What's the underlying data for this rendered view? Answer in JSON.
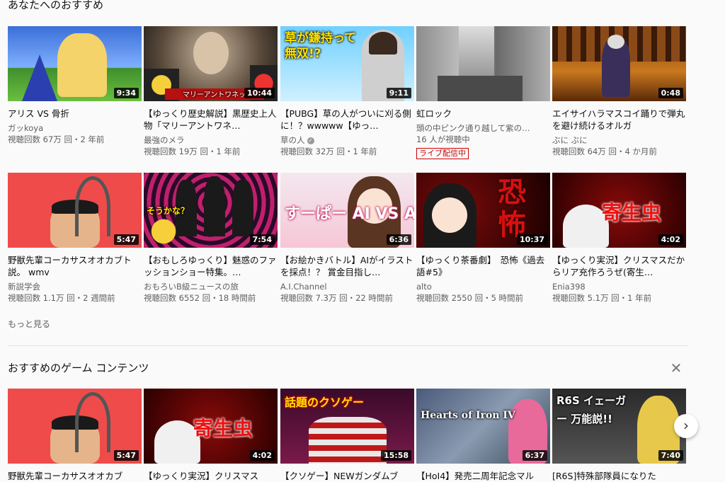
{
  "sections": {
    "recommended": "あなたへのおすすめ",
    "games": "おすすめのゲーム コンテンツ",
    "show_more": "もっと見る"
  },
  "icons": {
    "close": "close-icon",
    "next": "chevron-right-icon",
    "verified": "verified-check-icon"
  },
  "videos": [
    {
      "title": "アリス VS 骨折",
      "channel": "ガッkoya",
      "stats": "視聴回数 67万 回・2 年前",
      "duration": "9:34",
      "caption": ""
    },
    {
      "title": "【ゆっくり歴史解説】黒歴史上人物「マリーアントワネ…",
      "channel": "最強のメラ",
      "stats": "視聴回数 19万 回・1 年前",
      "duration": "10:44",
      "caption": "マリーアントワネット"
    },
    {
      "title": "【PUBG】草の人がついに刈る側に！？wwwww【ゆっ…",
      "channel": "草の人",
      "stats": "視聴回数 32万 回・1 年前",
      "duration": "9:11",
      "caption": "草が鎌持って 無双!?"
    },
    {
      "title": "虹ロック",
      "channel": "頭の中ピンク通り越して紫の…",
      "stats": "16 人が視聴中",
      "duration": "",
      "caption": "",
      "live": "ライブ配信中"
    },
    {
      "title": "エイサイハラマスコイ踊りで弾丸を避け続けるオルガ",
      "channel": "ぶに ぶに",
      "stats": "視聴回数 64万 回・4 か月前",
      "duration": "0:48",
      "caption": ""
    },
    {
      "title": "野獣先輩コーカサスオオカブト説。 wmv",
      "channel": "新説学会",
      "stats": "視聴回数 1.1万 回・2 週間前",
      "duration": "5:47",
      "caption": ""
    },
    {
      "title": "【おもしろゆっくり】魅惑のファッションショー特集。…",
      "channel": "おもろいB級ニュースの旅",
      "stats": "視聴回数 6552 回・18 時間前",
      "duration": "7:54",
      "caption": "そうかな？"
    },
    {
      "title": "【お絵かきバトル】AIがイラストを採点！？ 賞金目指し…",
      "channel": "A.I.Channel",
      "stats": "視聴回数 7.3万 回・22 時間前",
      "duration": "6:36",
      "caption": "すーぱー AI VS AI"
    },
    {
      "title": "【ゆっくり茶番劇】　恐怖《過去語#5》",
      "channel": "alto",
      "stats": "視聴回数 2550 回・5 時間前",
      "duration": "10:37",
      "caption": "恐怖"
    },
    {
      "title": "【ゆっくり実況】クリスマスだからリア充作ろうぜ(寄生…",
      "channel": "Enia398",
      "stats": "視聴回数 5.1万 回・1 年前",
      "duration": "4:02",
      "caption": "寄生虫"
    }
  ],
  "game_videos": [
    {
      "title": "野獣先輩コーカサスオオカブ",
      "duration": "5:47",
      "caption": ""
    },
    {
      "title": "【ゆっくり実況】クリスマス",
      "duration": "4:02",
      "caption": "寄生虫"
    },
    {
      "title": "【クソゲー】NEWガンダムブ",
      "duration": "15:58",
      "caption": "話題のクソゲー"
    },
    {
      "title": "【HoI4】発売二周年記念マル",
      "duration": "6:37",
      "caption": "Hearts of Iron IV"
    },
    {
      "title": "[R6S]特殊部隊員になりた",
      "duration": "7:40",
      "caption": "R6S イェーガー 万能説!!"
    }
  ],
  "colors": {
    "live_red": "#cc0000",
    "background": "#fafafa"
  }
}
